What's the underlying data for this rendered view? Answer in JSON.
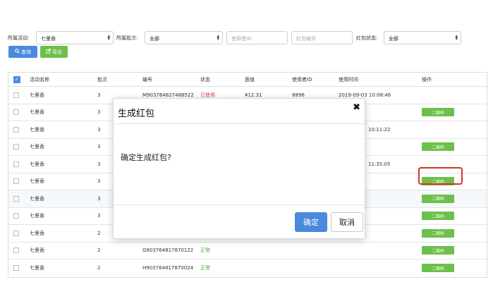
{
  "filters": {
    "activity_label": "所属活动:",
    "activity_value": "七里香",
    "batch_label": "所属批次:",
    "batch_value": "全部",
    "user_id_placeholder": "使用者ID",
    "packet_no_placeholder": "红包编号",
    "status_label": "红包状态:",
    "status_value": "全部"
  },
  "toolbar": {
    "query_label": "查询",
    "export_label": "导出"
  },
  "table": {
    "headers": [
      "活动名称",
      "批次",
      "编号",
      "状态",
      "面值",
      "使用者ID",
      "使用时间",
      "操作"
    ],
    "rows": [
      {
        "name": "七里香",
        "batch": "3",
        "no": "M903764827488522",
        "status": "已使用",
        "value": "¥12.31",
        "user": "8896",
        "time": "2019-09-03 10:08:46",
        "action": ""
      },
      {
        "name": "七里香",
        "batch": "3",
        "no": "",
        "status": "",
        "value": "",
        "user": "",
        "time": "",
        "action": "二维码"
      },
      {
        "name": "七里香",
        "batch": "3",
        "no": "",
        "status": "",
        "value": "",
        "user": "",
        "time": "10:11:22",
        "action": ""
      },
      {
        "name": "七里香",
        "batch": "3",
        "no": "",
        "status": "",
        "value": "",
        "user": "",
        "time": "",
        "action": "二维码"
      },
      {
        "name": "七里香",
        "batch": "3",
        "no": "",
        "status": "",
        "value": "",
        "user": "",
        "time": "11:35:05",
        "action": ""
      },
      {
        "name": "七里香",
        "batch": "3",
        "no": "",
        "status": "",
        "value": "",
        "user": "",
        "time": "",
        "action": "二维码"
      },
      {
        "name": "七里香",
        "batch": "3",
        "no": "",
        "status": "",
        "value": "",
        "user": "",
        "time": "",
        "action": "二维码"
      },
      {
        "name": "七里香",
        "batch": "3",
        "no": "",
        "status": "",
        "value": "",
        "user": "",
        "time": "",
        "action": "二维码"
      },
      {
        "name": "七里香",
        "batch": "2",
        "no": "",
        "status": "",
        "value": "",
        "user": "",
        "time": "",
        "action": "二维码"
      },
      {
        "name": "七里香",
        "batch": "2",
        "no": "G903764817870122",
        "status": "正常",
        "value": "",
        "user": "",
        "time": "",
        "action": "二维码"
      },
      {
        "name": "七里香",
        "batch": "2",
        "no": "H903764817870024",
        "status": "正常",
        "value": "",
        "user": "",
        "time": "",
        "action": "二维码"
      }
    ]
  },
  "modal": {
    "title": "生成红包",
    "message": "确定生成红包?",
    "confirm_label": "确定",
    "cancel_label": "取消",
    "close_glyph": "✖"
  },
  "icons": {
    "query": "search-icon",
    "export": "export-icon",
    "close": "close-icon"
  },
  "colors": {
    "primary": "#4a89dc",
    "success": "#6cc04a",
    "status_used": "#e03b3b",
    "status_ok": "#45a835",
    "highlight_box": "#d9312a"
  }
}
